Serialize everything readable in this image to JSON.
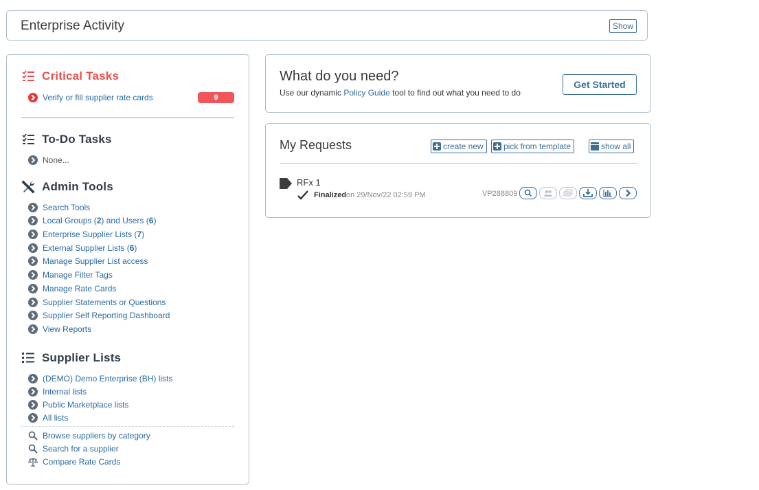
{
  "enterprise_activity": {
    "title": "Enterprise Activity",
    "show_label": "Show"
  },
  "critical_tasks": {
    "title": "Critical Tasks",
    "items": [
      {
        "label": "Verify or fill supplier rate cards",
        "count": "9"
      }
    ]
  },
  "todo_tasks": {
    "title": "To-Do Tasks",
    "items": [
      {
        "label": "None..."
      }
    ]
  },
  "admin_tools": {
    "title": "Admin Tools",
    "items": [
      {
        "label": "Search Tools"
      },
      {
        "label_pre": "Local Groups (",
        "n1": "2",
        "label_mid": ") and Users (",
        "n2": "6",
        "label_post": ")"
      },
      {
        "label_pre": "Enterprise Supplier Lists (",
        "n1": "7",
        "label_post": ")"
      },
      {
        "label_pre": "External Supplier Lists (",
        "n1": "6",
        "label_post": ")"
      },
      {
        "label": "Manage Supplier List access"
      },
      {
        "label": "Manage Filter Tags"
      },
      {
        "label": "Manage Rate Cards"
      },
      {
        "label": "Supplier Statements or Questions"
      },
      {
        "label": "Supplier Self Reporting Dashboard"
      },
      {
        "label": "View Reports"
      }
    ]
  },
  "supplier_lists": {
    "title": "Supplier Lists",
    "items": [
      {
        "label": "(DEMO) Demo Enterprise (BH) lists"
      },
      {
        "label": "Internal lists"
      },
      {
        "label": "Public Marketplace lists"
      },
      {
        "label": "All lists"
      }
    ],
    "search_items": [
      {
        "label": "Browse suppliers by category",
        "icon": "magnifier-icon"
      },
      {
        "label": "Search for a supplier",
        "icon": "magnifier-icon"
      },
      {
        "label": "Compare Rate Cards",
        "icon": "scale-icon"
      }
    ]
  },
  "need": {
    "title": "What do you need?",
    "sub_pre": "Use our dynamic ",
    "sub_link": "Policy Guide",
    "sub_post": " tool to find out what you need to do",
    "button": "Get Started"
  },
  "requests": {
    "title": "My Requests",
    "create_new": "create new",
    "pick_template": "pick from template",
    "show_all": "show all",
    "rows": [
      {
        "name": "RFx 1",
        "status": "Finalized",
        "date": "on 29/Nov/22 02:59 PM",
        "id": "VP288809"
      }
    ]
  },
  "colors": {
    "accent": "#3c6e99",
    "link": "#2a6aa1",
    "critical": "#e8504b",
    "badge": "#f0555a"
  }
}
